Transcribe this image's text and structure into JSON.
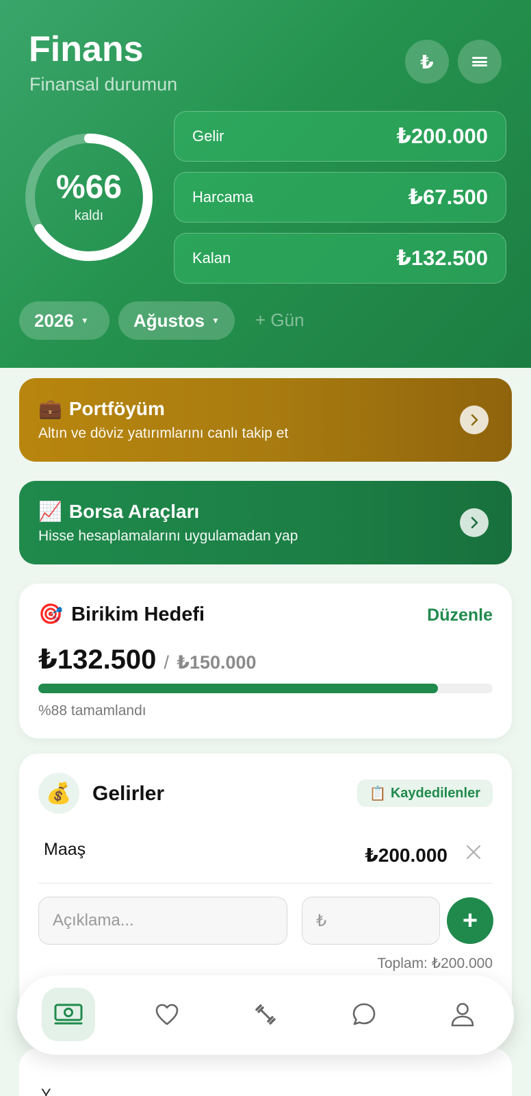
{
  "header": {
    "title": "Finans",
    "subtitle": "Finansal durumun",
    "currency_button": "₺",
    "ring": {
      "percent_label": "%66",
      "caption": "kaldı",
      "fraction": 0.66
    },
    "stats": [
      {
        "label": "Gelir",
        "value": "₺200.000"
      },
      {
        "label": "Harcama",
        "value": "₺67.500"
      },
      {
        "label": "Kalan",
        "value": "₺132.500"
      }
    ],
    "year": "2026",
    "month": "Ağustos",
    "add_day": "+ Gün"
  },
  "banners": [
    {
      "emoji": "💼",
      "title": "Portföyüm",
      "subtitle": "Altın ve döviz yatırımlarını canlı takip et",
      "color": "#b8860e"
    },
    {
      "emoji": "📈",
      "title": "Borsa Araçları",
      "subtitle": "Hisse hesaplamalarını uygulamadan yap",
      "color": "#1f8a4c"
    }
  ],
  "goal": {
    "emoji": "🎯",
    "title": "Birikim Hedefi",
    "edit_label": "Düzenle",
    "current": "₺132.500",
    "separator": "/",
    "target": "₺150.000",
    "progress": 0.88,
    "status": "%88 tamamlandı"
  },
  "income": {
    "emoji": "💰",
    "title": "Gelirler",
    "saved_emoji": "📋",
    "saved_label": "Kaydedilenler",
    "items": [
      {
        "name": "Maaş",
        "amount": "₺200.000"
      }
    ],
    "desc_placeholder": "Açıklama...",
    "amount_placeholder": "₺",
    "add_label": "+",
    "total": "Toplam: ₺200.000"
  },
  "partial_next": {
    "label": "Y..."
  },
  "tabbar": {
    "tabs": [
      {
        "icon": "money-icon",
        "active": true
      },
      {
        "icon": "heart-icon",
        "active": false
      },
      {
        "icon": "dumbbell-icon",
        "active": false
      },
      {
        "icon": "chat-bubble-icon",
        "active": false
      },
      {
        "icon": "profile-icon",
        "active": false
      }
    ]
  },
  "colors": {
    "accent": "#1f8a4c",
    "gold": "#b8860e",
    "header": "#2a9a58"
  }
}
